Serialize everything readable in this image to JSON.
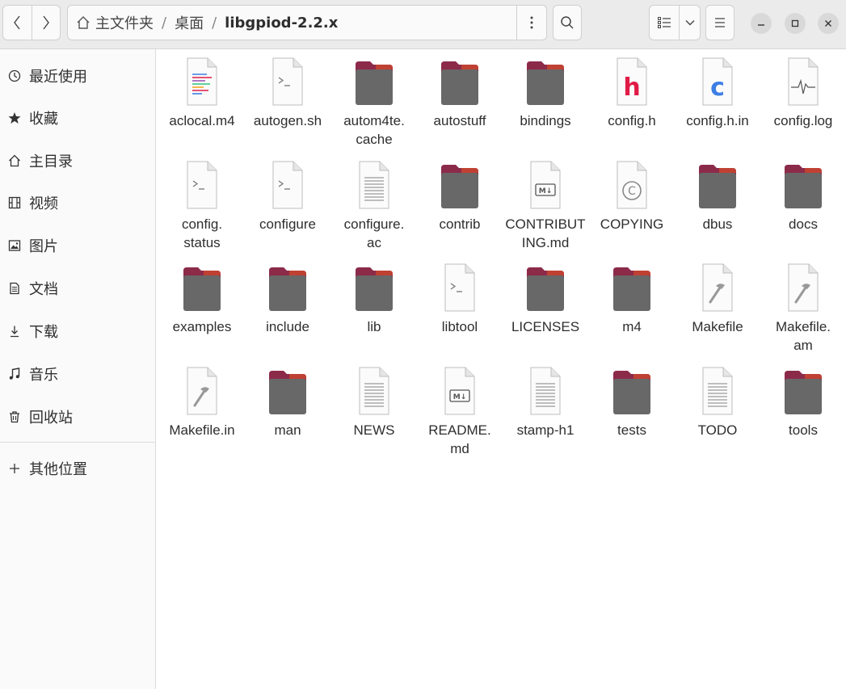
{
  "header": {
    "breadcrumbs": [
      "主文件夹",
      "桌面",
      "libgpiod-2.2.x"
    ]
  },
  "sidebar": {
    "items": [
      {
        "label": "最近使用",
        "icon": "clock-icon"
      },
      {
        "label": "收藏",
        "icon": "star-icon"
      },
      {
        "label": "主目录",
        "icon": "home-icon"
      },
      {
        "label": "视频",
        "icon": "film-icon"
      },
      {
        "label": "图片",
        "icon": "picture-icon"
      },
      {
        "label": "文档",
        "icon": "document-icon"
      },
      {
        "label": "下载",
        "icon": "download-icon"
      },
      {
        "label": "音乐",
        "icon": "music-icon"
      },
      {
        "label": "回收站",
        "icon": "trash-icon"
      },
      {
        "label": "其他位置",
        "icon": "plus-icon"
      }
    ]
  },
  "files": [
    {
      "name": "aclocal.m4",
      "label": [
        "aclocal.m4"
      ],
      "type": "text-colored"
    },
    {
      "name": "autogen.sh",
      "label": [
        "autogen.sh"
      ],
      "type": "script"
    },
    {
      "name": "autom4te.cache",
      "label": [
        "autom4te.",
        "cache"
      ],
      "type": "folder"
    },
    {
      "name": "autostuff",
      "label": [
        "autostuff"
      ],
      "type": "folder"
    },
    {
      "name": "bindings",
      "label": [
        "bindings"
      ],
      "type": "folder"
    },
    {
      "name": "config.h",
      "label": [
        "config.h"
      ],
      "type": "h-source"
    },
    {
      "name": "config.h.in",
      "label": [
        "config.h.in"
      ],
      "type": "c-source"
    },
    {
      "name": "config.log",
      "label": [
        "config.log"
      ],
      "type": "log"
    },
    {
      "name": "config.status",
      "label": [
        "config.",
        "status"
      ],
      "type": "script"
    },
    {
      "name": "configure",
      "label": [
        "configure"
      ],
      "type": "script"
    },
    {
      "name": "configure.ac",
      "label": [
        "configure.",
        "ac"
      ],
      "type": "text"
    },
    {
      "name": "contrib",
      "label": [
        "contrib"
      ],
      "type": "folder"
    },
    {
      "name": "CONTRIBUTING.md",
      "label": [
        "CONTRIBUT",
        "ING.md"
      ],
      "type": "markdown"
    },
    {
      "name": "COPYING",
      "label": [
        "COPYING"
      ],
      "type": "copyright"
    },
    {
      "name": "dbus",
      "label": [
        "dbus"
      ],
      "type": "folder"
    },
    {
      "name": "docs",
      "label": [
        "docs"
      ],
      "type": "folder"
    },
    {
      "name": "examples",
      "label": [
        "examples"
      ],
      "type": "folder"
    },
    {
      "name": "include",
      "label": [
        "include"
      ],
      "type": "folder"
    },
    {
      "name": "lib",
      "label": [
        "lib"
      ],
      "type": "folder"
    },
    {
      "name": "libtool",
      "label": [
        "libtool"
      ],
      "type": "script"
    },
    {
      "name": "LICENSES",
      "label": [
        "LICENSES"
      ],
      "type": "folder"
    },
    {
      "name": "m4",
      "label": [
        "m4"
      ],
      "type": "folder"
    },
    {
      "name": "Makefile",
      "label": [
        "Makefile"
      ],
      "type": "makefile"
    },
    {
      "name": "Makefile.am",
      "label": [
        "Makefile.",
        "am"
      ],
      "type": "makefile"
    },
    {
      "name": "Makefile.in",
      "label": [
        "Makefile.in"
      ],
      "type": "makefile"
    },
    {
      "name": "man",
      "label": [
        "man"
      ],
      "type": "folder"
    },
    {
      "name": "NEWS",
      "label": [
        "NEWS"
      ],
      "type": "text"
    },
    {
      "name": "README.md",
      "label": [
        "README.",
        "md"
      ],
      "type": "markdown"
    },
    {
      "name": "stamp-h1",
      "label": [
        "stamp-h1"
      ],
      "type": "text"
    },
    {
      "name": "tests",
      "label": [
        "tests"
      ],
      "type": "folder"
    },
    {
      "name": "TODO",
      "label": [
        "TODO"
      ],
      "type": "text"
    },
    {
      "name": "tools",
      "label": [
        "tools"
      ],
      "type": "folder"
    }
  ],
  "colors": {
    "folder_body": "#686868",
    "folder_tab": "#8c2a4a",
    "folder_tab_accent": "#e95420",
    "h_letter": "#e01b46",
    "c_letter": "#3d7ee4"
  }
}
